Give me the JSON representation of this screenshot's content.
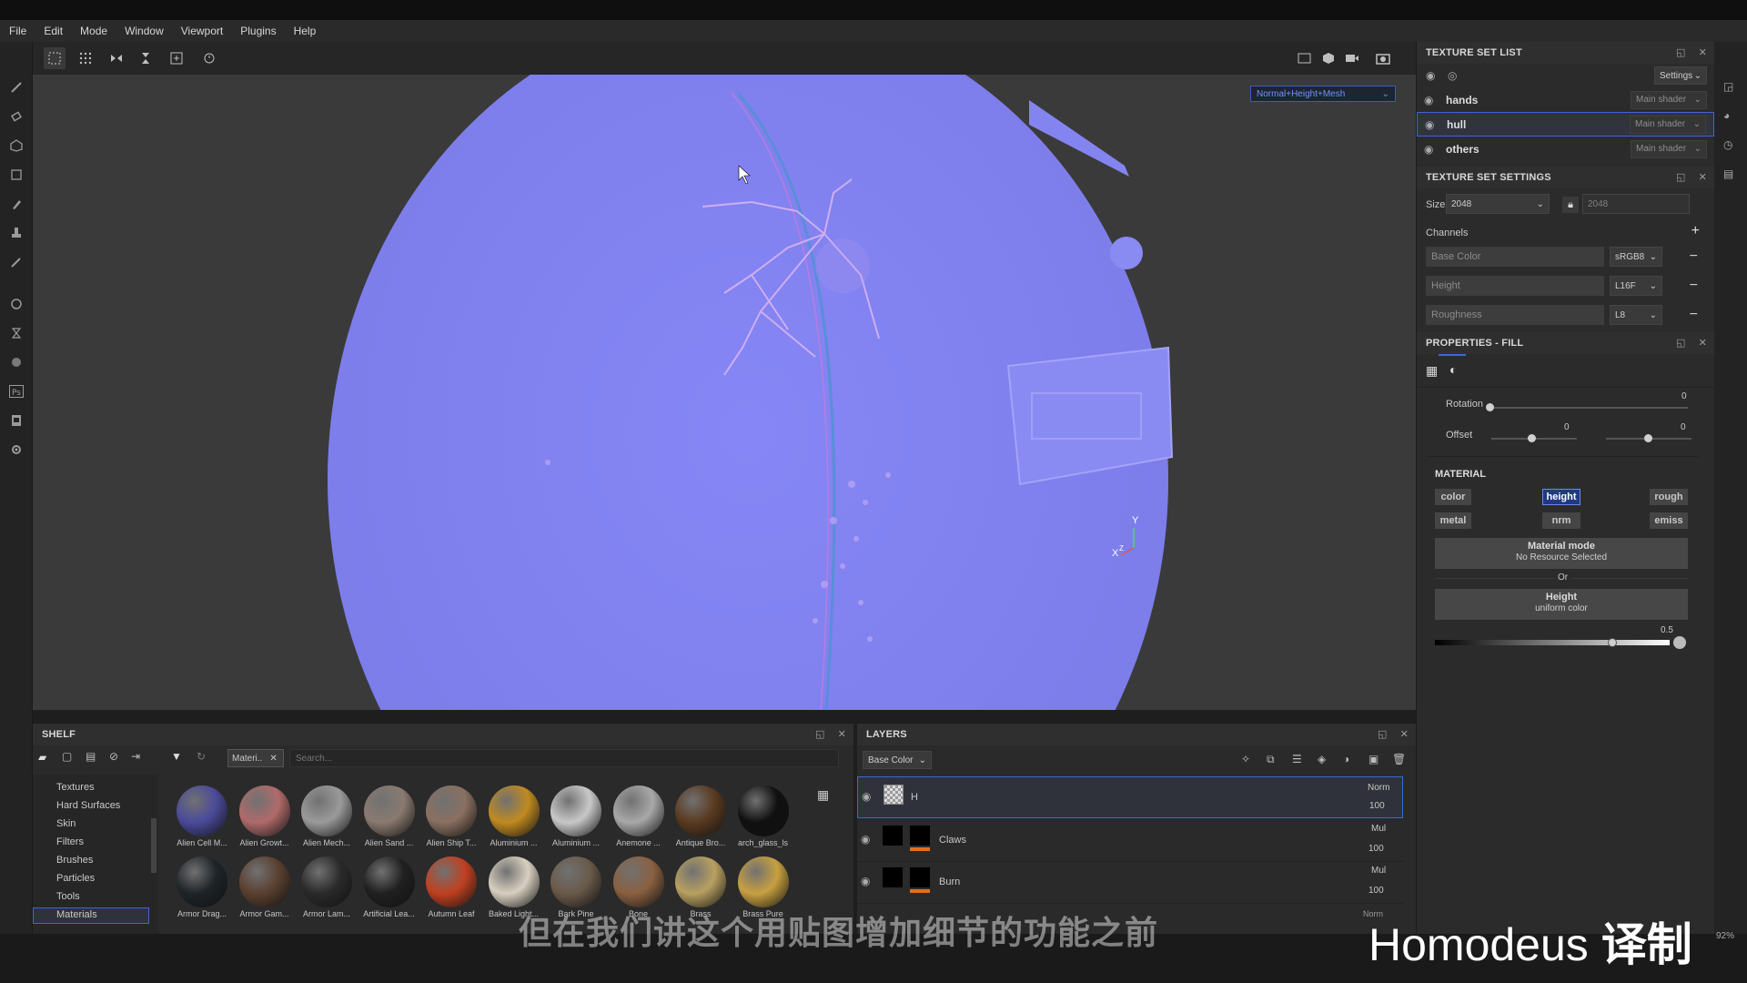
{
  "menu": [
    "File",
    "Edit",
    "Mode",
    "Window",
    "Viewport",
    "Plugins",
    "Help"
  ],
  "viewport": {
    "mode_dropdown": "Normal+Height+Mesh",
    "axis_x": "X",
    "axis_y": "Y",
    "axis_z": "Z"
  },
  "texture_set_list": {
    "title": "TEXTURE SET LIST",
    "settings_label": "Settings",
    "items": [
      {
        "name": "hands",
        "shader": "Main shader"
      },
      {
        "name": "hull",
        "shader": "Main shader"
      },
      {
        "name": "others",
        "shader": "Main shader"
      }
    ]
  },
  "texture_set_settings": {
    "title": "TEXTURE SET SETTINGS",
    "size_label": "Size",
    "size_value": "2048",
    "size_value_locked": "2048",
    "channels_label": "Channels",
    "channels": [
      {
        "name": "Base Color",
        "format": "sRGB8"
      },
      {
        "name": "Height",
        "format": "L16F"
      },
      {
        "name": "Roughness",
        "format": "L8"
      }
    ]
  },
  "properties_fill": {
    "title": "PROPERTIES - FILL",
    "rotation_label": "Rotation",
    "rotation_value": "0",
    "offset_label": "Offset",
    "offset_x": "0",
    "offset_y": "0",
    "material_title": "MATERIAL",
    "buttons": [
      "color",
      "height",
      "rough",
      "metal",
      "nrm",
      "emiss"
    ],
    "material_mode_title": "Material mode",
    "material_mode_sub": "No Resource Selected",
    "or_label": "Or",
    "height_title": "Height",
    "height_sub": "uniform color",
    "height_value": "0.5"
  },
  "shelf": {
    "title": "SHELF",
    "filter_tag": "Materi..",
    "search_placeholder": "Search...",
    "categories": [
      "Textures",
      "Hard Surfaces",
      "Skin",
      "Filters",
      "Brushes",
      "Particles",
      "Tools",
      "Materials"
    ],
    "row1": [
      "Alien Cell M...",
      "Alien Growt...",
      "Alien Mech...",
      "Alien Sand ...",
      "Alien Ship T...",
      "Aluminium ...",
      "Aluminium ...",
      "Anemone ...",
      "Antique Bro...",
      "arch_glass_ls"
    ],
    "row2": [
      "Armor Drag...",
      "Armor Gam...",
      "Armor Lam...",
      "Artificial Lea...",
      "Autumn Leaf",
      "Baked Light...",
      "Bark Pine",
      "Bone",
      "Brass",
      "Brass Pure"
    ]
  },
  "layers": {
    "title": "LAYERS",
    "channel_select": "Base Color",
    "rows": [
      {
        "name": "H",
        "blend": "Norm",
        "opacity": "100"
      },
      {
        "name": "Claws",
        "blend": "Mul",
        "opacity": "100"
      },
      {
        "name": "Burn",
        "blend": "Mul",
        "opacity": "100"
      }
    ],
    "partial_blend": "Norm"
  },
  "overlay": {
    "subtitle": "但在我们讲这个用贴图增加细节的功能之前",
    "watermark_name": "Homodeus",
    "watermark_suffix": "译制",
    "zoom": "92%"
  }
}
